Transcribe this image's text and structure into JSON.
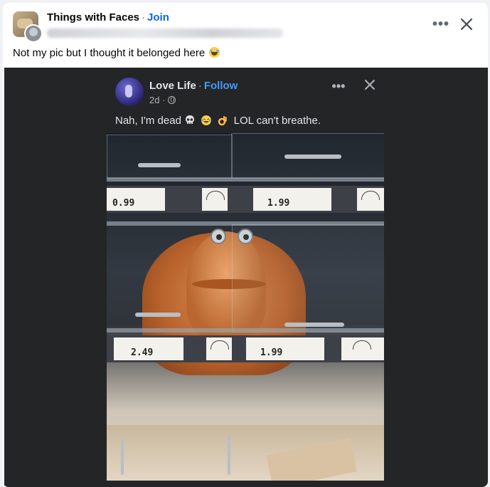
{
  "post": {
    "group_name": "Things with Faces",
    "separator": "·",
    "join_label": "Join",
    "more_label": "•••",
    "caption": "Not my pic but I thought it belonged here",
    "caption_emoji": "laughing-with-tears-emoji"
  },
  "embedded": {
    "page_name": "Love Life",
    "separator": "·",
    "follow_label": "Follow",
    "time": "2d ·",
    "more_label": "•••",
    "caption_start": "Nah, I'm dead",
    "caption_end": "LOL can't breathe.",
    "emojis": [
      "skull-emoji",
      "laughing-with-tears-emoji",
      "ok-hand-emoji"
    ]
  },
  "photo": {
    "top_prices": [
      "0.99",
      "1.99"
    ],
    "bottom_prices": [
      "2.49",
      "1.99"
    ]
  },
  "colors": {
    "link_blue": "#0866ff",
    "follow_blue": "#4599ff",
    "dark_bg": "#242526"
  }
}
